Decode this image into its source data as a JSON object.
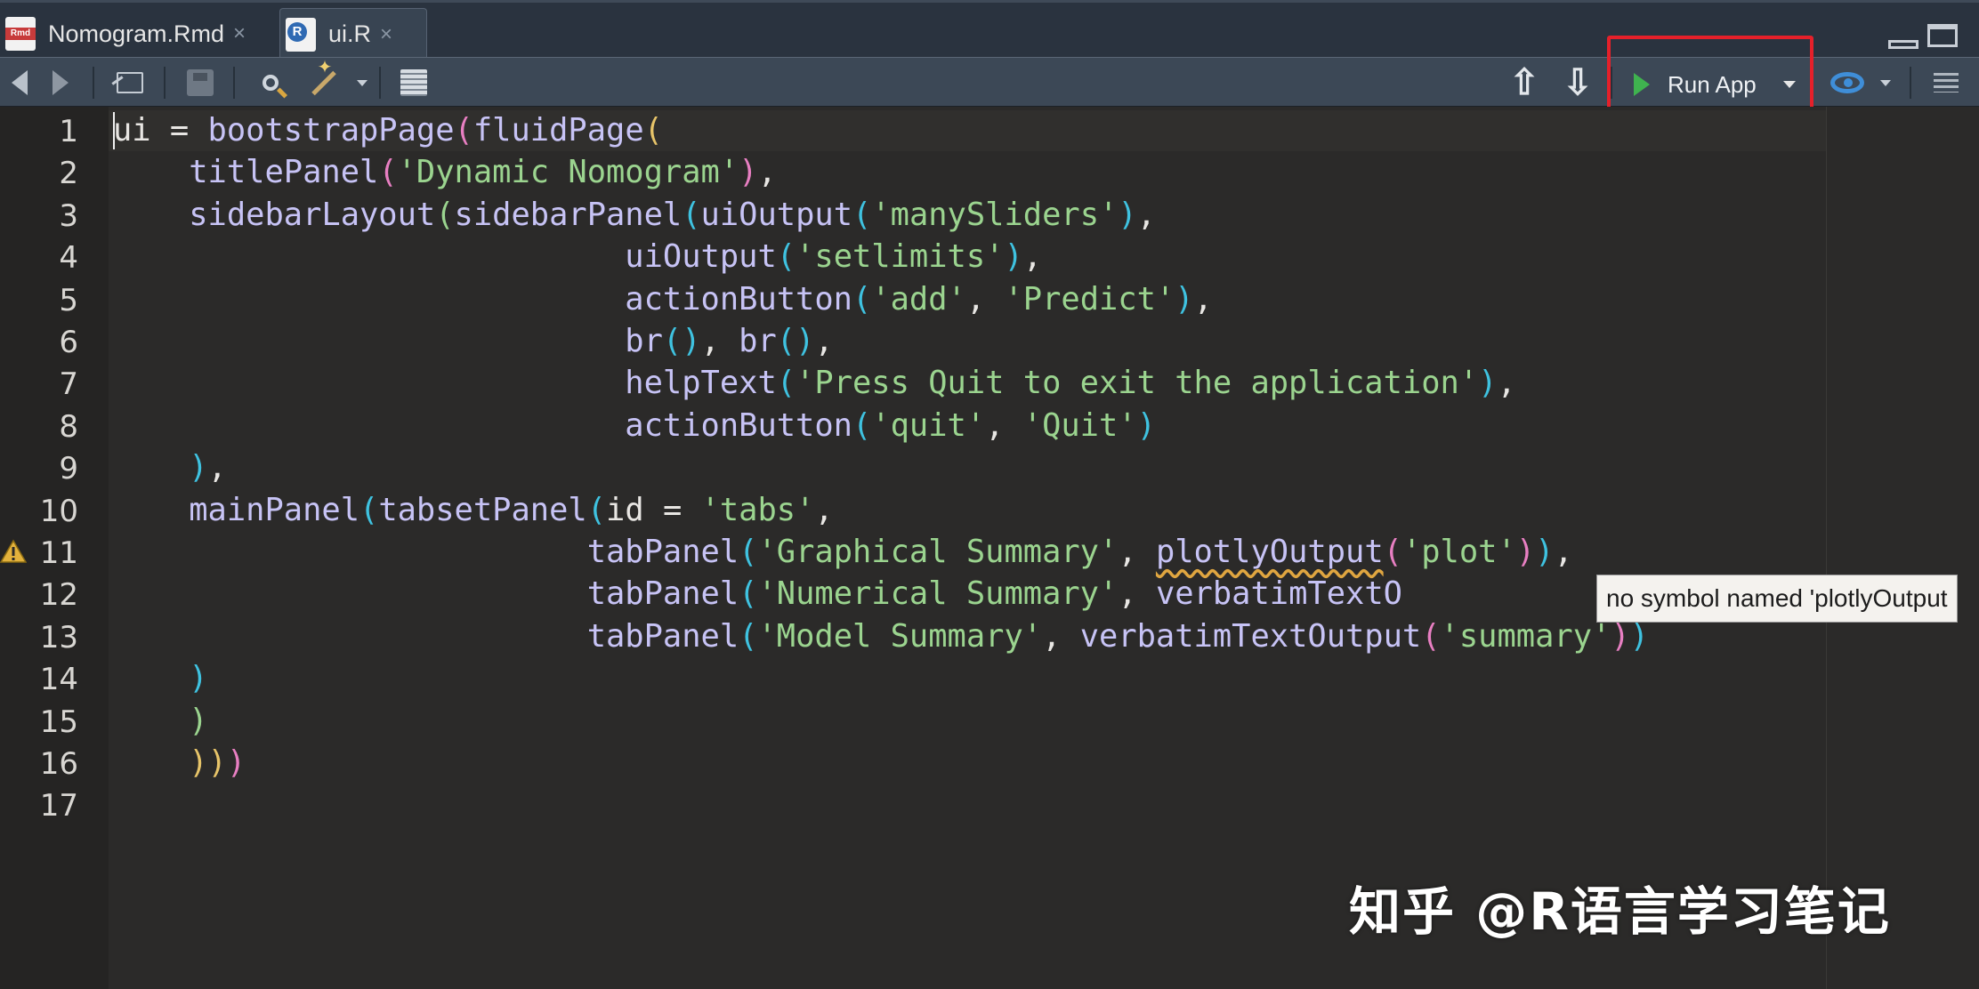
{
  "tabs": [
    {
      "label": "Nomogram.Rmd",
      "icon": "rmd-file-icon",
      "active": false
    },
    {
      "label": "ui.R",
      "icon": "r-file-icon",
      "active": true
    }
  ],
  "tab_close_glyph": "×",
  "toolbar": {
    "run_app_label": "Run App"
  },
  "editor": {
    "line_numbers": [
      "1",
      "2",
      "3",
      "4",
      "5",
      "6",
      "7",
      "8",
      "9",
      "10",
      "11",
      "12",
      "13",
      "14",
      "15",
      "16",
      "17"
    ],
    "lines": [
      [
        {
          "t": "ui",
          "c": "k"
        },
        {
          "t": " = ",
          "c": "o"
        },
        {
          "t": "bootstrapPage",
          "c": "f"
        },
        {
          "t": "(",
          "c": "p2"
        },
        {
          "t": "fluidPage",
          "c": "f"
        },
        {
          "t": "(",
          "c": "p1"
        }
      ],
      [
        {
          "t": "    ",
          "c": "o"
        },
        {
          "t": "titlePanel",
          "c": "f"
        },
        {
          "t": "(",
          "c": "p2"
        },
        {
          "t": "'Dynamic Nomogram'",
          "c": "s"
        },
        {
          "t": ")",
          "c": "p2"
        },
        {
          "t": ",",
          "c": "o"
        }
      ],
      [
        {
          "t": "    ",
          "c": "o"
        },
        {
          "t": "sidebarLayout",
          "c": "f"
        },
        {
          "t": "(",
          "c": "p4"
        },
        {
          "t": "sidebarPanel",
          "c": "f"
        },
        {
          "t": "(",
          "c": "p3"
        },
        {
          "t": "uiOutput",
          "c": "f"
        },
        {
          "t": "(",
          "c": "p3"
        },
        {
          "t": "'manySliders'",
          "c": "s"
        },
        {
          "t": ")",
          "c": "p3"
        },
        {
          "t": ",",
          "c": "o"
        }
      ],
      [
        {
          "t": "                           ",
          "c": "o"
        },
        {
          "t": "uiOutput",
          "c": "f"
        },
        {
          "t": "(",
          "c": "p3"
        },
        {
          "t": "'setlimits'",
          "c": "s"
        },
        {
          "t": ")",
          "c": "p3"
        },
        {
          "t": ",",
          "c": "o"
        }
      ],
      [
        {
          "t": "                           ",
          "c": "o"
        },
        {
          "t": "actionButton",
          "c": "f"
        },
        {
          "t": "(",
          "c": "p3"
        },
        {
          "t": "'add'",
          "c": "s"
        },
        {
          "t": ", ",
          "c": "o"
        },
        {
          "t": "'Predict'",
          "c": "s"
        },
        {
          "t": ")",
          "c": "p3"
        },
        {
          "t": ",",
          "c": "o"
        }
      ],
      [
        {
          "t": "                           ",
          "c": "o"
        },
        {
          "t": "br",
          "c": "f"
        },
        {
          "t": "()",
          "c": "p3"
        },
        {
          "t": ", ",
          "c": "o"
        },
        {
          "t": "br",
          "c": "f"
        },
        {
          "t": "()",
          "c": "p3"
        },
        {
          "t": ",",
          "c": "o"
        }
      ],
      [
        {
          "t": "                           ",
          "c": "o"
        },
        {
          "t": "helpText",
          "c": "f"
        },
        {
          "t": "(",
          "c": "p3"
        },
        {
          "t": "'Press Quit to exit the application'",
          "c": "s"
        },
        {
          "t": ")",
          "c": "p3"
        },
        {
          "t": ",",
          "c": "o"
        }
      ],
      [
        {
          "t": "                           ",
          "c": "o"
        },
        {
          "t": "actionButton",
          "c": "f"
        },
        {
          "t": "(",
          "c": "p3"
        },
        {
          "t": "'quit'",
          "c": "s"
        },
        {
          "t": ", ",
          "c": "o"
        },
        {
          "t": "'Quit'",
          "c": "s"
        },
        {
          "t": ")",
          "c": "p3"
        }
      ],
      [
        {
          "t": "    ",
          "c": "o"
        },
        {
          "t": ")",
          "c": "p3"
        },
        {
          "t": ",",
          "c": "o"
        }
      ],
      [
        {
          "t": "    ",
          "c": "o"
        },
        {
          "t": "mainPanel",
          "c": "f"
        },
        {
          "t": "(",
          "c": "p3"
        },
        {
          "t": "tabsetPanel",
          "c": "f"
        },
        {
          "t": "(",
          "c": "p3"
        },
        {
          "t": "id",
          "c": "k"
        },
        {
          "t": " = ",
          "c": "o"
        },
        {
          "t": "'tabs'",
          "c": "s"
        },
        {
          "t": ",",
          "c": "o"
        }
      ],
      [
        {
          "t": "                         ",
          "c": "o"
        },
        {
          "t": "tabPanel",
          "c": "f"
        },
        {
          "t": "(",
          "c": "p3"
        },
        {
          "t": "'Graphical Summary'",
          "c": "s"
        },
        {
          "t": ", ",
          "c": "o"
        },
        {
          "t": "plotlyOutput",
          "c": "f squig"
        },
        {
          "t": "(",
          "c": "p2"
        },
        {
          "t": "'plot'",
          "c": "s"
        },
        {
          "t": ")",
          "c": "p2"
        },
        {
          "t": ")",
          "c": "p3"
        },
        {
          "t": ",",
          "c": "o"
        }
      ],
      [
        {
          "t": "                         ",
          "c": "o"
        },
        {
          "t": "tabPanel",
          "c": "f"
        },
        {
          "t": "(",
          "c": "p3"
        },
        {
          "t": "'Numerical Summary'",
          "c": "s"
        },
        {
          "t": ", ",
          "c": "o"
        },
        {
          "t": "verbatimTextO",
          "c": "f"
        }
      ],
      [
        {
          "t": "                         ",
          "c": "o"
        },
        {
          "t": "tabPanel",
          "c": "f"
        },
        {
          "t": "(",
          "c": "p3"
        },
        {
          "t": "'Model Summary'",
          "c": "s"
        },
        {
          "t": ", ",
          "c": "o"
        },
        {
          "t": "verbatimTextOutput",
          "c": "f"
        },
        {
          "t": "(",
          "c": "p2"
        },
        {
          "t": "'summary'",
          "c": "s"
        },
        {
          "t": ")",
          "c": "p2"
        },
        {
          "t": ")",
          "c": "p3"
        }
      ],
      [
        {
          "t": "    ",
          "c": "o"
        },
        {
          "t": ")",
          "c": "p3"
        }
      ],
      [
        {
          "t": "    ",
          "c": "o"
        },
        {
          "t": ")",
          "c": "p4"
        }
      ],
      [
        {
          "t": "    ",
          "c": "o"
        },
        {
          "t": ")",
          "c": "p1"
        },
        {
          "t": ")",
          "c": "p1"
        },
        {
          "t": ")",
          "c": "p2"
        }
      ],
      []
    ],
    "warning_line": 11
  },
  "tooltip": "no symbol named 'plotlyOutput",
  "watermark": "知乎 @R语言学习笔记",
  "colors": {
    "run_highlight": "#e5202a",
    "play": "#3fb34f",
    "string": "#9bd48f",
    "function": "#c7c3f5"
  }
}
